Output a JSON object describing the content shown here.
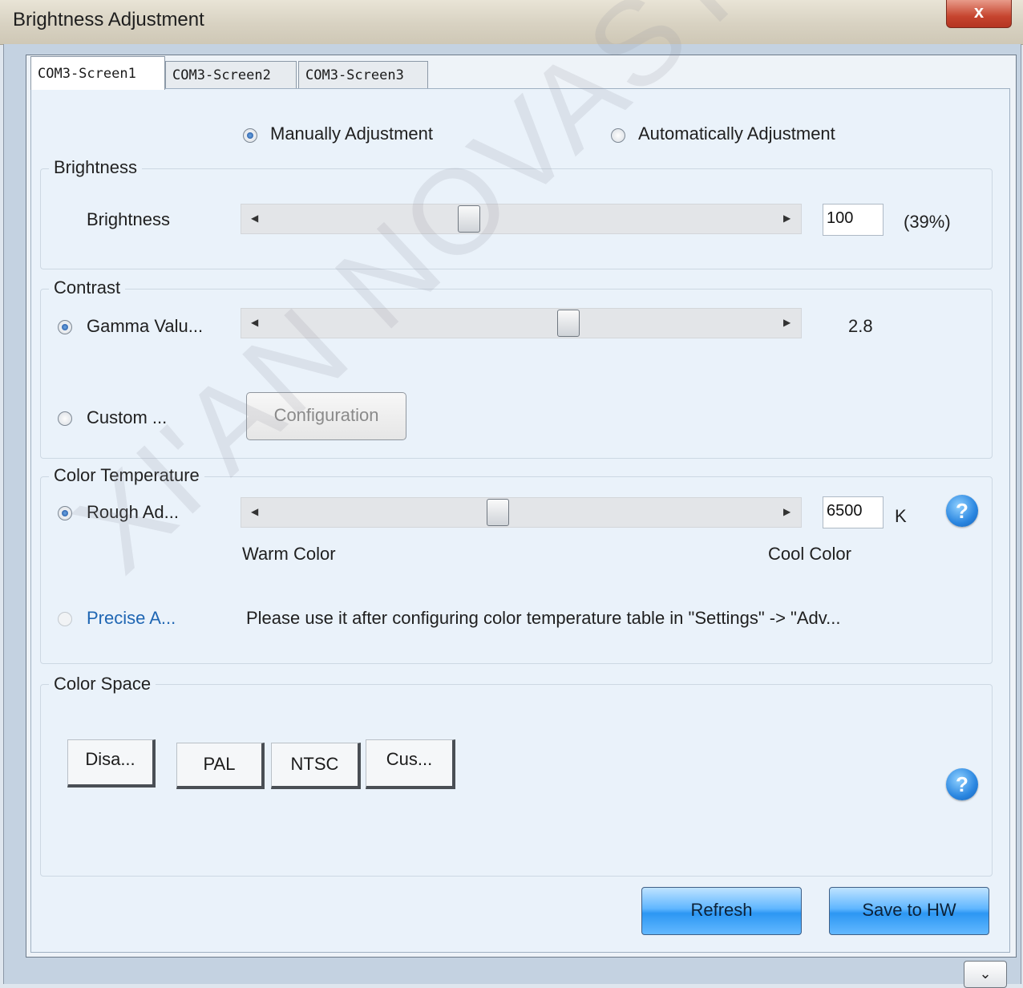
{
  "window": {
    "title": "Brightness Adjustment",
    "close_glyph": "x"
  },
  "tabs": [
    "COM3-Screen1",
    "COM3-Screen2",
    "COM3-Screen3"
  ],
  "mode": {
    "manual": "Manually Adjustment",
    "automatic": "Automatically Adjustment",
    "selected": "manual"
  },
  "brightness": {
    "group_label": "Brightness",
    "row_label": "Brightness",
    "value": "100",
    "percent": "(39%)",
    "slider_fraction": 0.39
  },
  "contrast": {
    "group_label": "Contrast",
    "gamma_label": "Gamma Valu...",
    "gamma_value": "2.8",
    "custom_label": "Custom ...",
    "configuration_button": "Configuration",
    "selected": "gamma"
  },
  "color_temperature": {
    "group_label": "Color Temperature",
    "rough_label": "Rough Ad...",
    "value": "6500",
    "unit": "K",
    "warm_label": "Warm Color",
    "cool_label": "Cool Color",
    "precise_label": "Precise A...",
    "precise_note": "Please use it after configuring color temperature table in \"Settings\" -> \"Adv...",
    "selected": "rough"
  },
  "color_space": {
    "group_label": "Color Space",
    "buttons": [
      "Disa...",
      "PAL",
      "NTSC",
      "Cus..."
    ]
  },
  "actions": {
    "refresh": "Refresh",
    "save": "Save to HW"
  },
  "watermark": "XI'AN NOVASTAR TECH CO., L",
  "icons": {
    "help": "help-icon",
    "close": "close-icon",
    "chevron": "chevron-down-icon",
    "left_arrow": "arrow-left-icon",
    "right_arrow": "arrow-right-icon"
  },
  "colors": {
    "accent": "#2d97f3",
    "link": "#1f66b3"
  }
}
